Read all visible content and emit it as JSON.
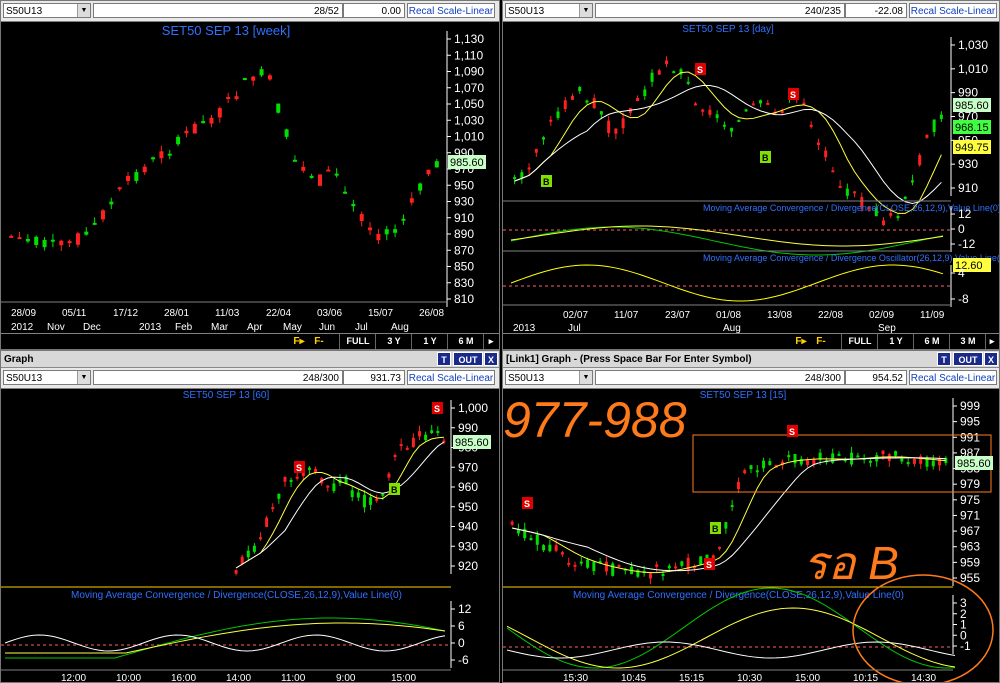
{
  "colors": {
    "up": "#00e000",
    "down": "#ff2020",
    "ma_fast": "#ffff40",
    "ma_slow": "#c8ff80",
    "macd_line": "#00c800",
    "signal_line": "#ffff40",
    "osc": "#ffff00",
    "label": "#3070ff",
    "axis": "#ffffff",
    "grid": "#404040",
    "overlay": "#ff7a1a"
  },
  "panels": {
    "tl": {
      "symbol": "S50U13",
      "field1": "28/52",
      "field2": "0.00",
      "recal": "Recal Scale-Linear",
      "title": "SET50 SEP 13  [week]",
      "yticks": [
        "1,130",
        "1,110",
        "1,090",
        "1,070",
        "1,050",
        "1,030",
        "1,010",
        "990",
        "970",
        "950",
        "930",
        "910",
        "890",
        "870",
        "850",
        "830",
        "810"
      ],
      "price_tag": "985.60",
      "xtick_top": [
        "28/09",
        "05/11",
        "17/12",
        "28/01",
        "11/03",
        "22/04",
        "03/06",
        "15/07",
        "26/08"
      ],
      "xtick_bottom": [
        "2012",
        "Nov",
        "Dec",
        "2013",
        "Feb",
        "Mar",
        "Apr",
        "May",
        "Jun",
        "Jul",
        "Aug"
      ],
      "bottom": {
        "full": "FULL",
        "y3": "3 Y",
        "y1": "1 Y",
        "m6": "6 M"
      }
    },
    "tr": {
      "symbol": "S50U13",
      "field1": "240/235",
      "field2": "-22.08",
      "recal": "Recal Scale-Linear",
      "title": "SET50 SEP 13  [day]",
      "yticks": [
        "1,030",
        "1,010",
        "990",
        "970",
        "950",
        "930",
        "910"
      ],
      "tags": [
        "985.60",
        "968.15",
        "949.75"
      ],
      "macd_title": "Moving Average Convergence / Divergence(CLOSE,26,12,9),Value Line(0)",
      "macd_ticks": [
        "12",
        "0",
        "-12"
      ],
      "osc_title": "Moving Average Convergence / Divergence Oscillator(26,12,9),Value Line(0)",
      "osc_tag": "12.60",
      "osc_ticks": [
        "4",
        "-8"
      ],
      "xtick_top": [
        "02/07",
        "11/07",
        "23/07",
        "01/08",
        "13/08",
        "22/08",
        "02/09",
        "11/09"
      ],
      "xtick_bottom": [
        "2013",
        "Jul",
        "Aug",
        "Sep"
      ],
      "bottom": {
        "full": "FULL",
        "y1": "1 Y",
        "m6": "6 M",
        "m3": "3 M"
      }
    },
    "bl": {
      "header": "Graph",
      "t": "T",
      "out": "OUT",
      "x": "X",
      "symbol": "S50U13",
      "field1": "248/300",
      "field2": "931.73",
      "recal": "Recal Scale-Linear",
      "title": "SET50 SEP 13  [60]",
      "yticks": [
        "1,000",
        "990",
        "980",
        "970",
        "960",
        "950",
        "940",
        "930",
        "920"
      ],
      "price_tag": "985.60",
      "macd_title": "Moving Average Convergence / Divergence(CLOSE,26,12,9),Value Line(0)",
      "macd_ticks": [
        "12",
        "6",
        "0",
        "-6"
      ],
      "xtick": [
        "12:00",
        "10:00",
        "16:00",
        "14:00",
        "11:00",
        "9:00",
        "15:00"
      ]
    },
    "br": {
      "header": "[Link1] Graph  - (Press Space Bar For Enter Symbol)",
      "t": "T",
      "out": "OUT",
      "x": "X",
      "symbol": "S50U13",
      "field1": "248/300",
      "field2": "954.52",
      "recal": "Recal Scale-Linear",
      "title": "SET50 SEP 13  [15]",
      "yticks": [
        "999",
        "995",
        "991",
        "987",
        "983",
        "979",
        "975",
        "971",
        "967",
        "963",
        "959",
        "955"
      ],
      "price_tag": "985.60",
      "macd_title": "Moving Average Convergence / Divergence(CLOSE,26,12,9),Value Line(0)",
      "macd_ticks": [
        "3",
        "2",
        "1",
        "0",
        "-1"
      ],
      "xtick": [
        "15:30",
        "10:45",
        "15:15",
        "10:30",
        "15:00",
        "10:15",
        "14:30"
      ]
    }
  },
  "overlay": {
    "range_text": "977-988",
    "wait_text": "รอ B"
  },
  "signals": {
    "s": "S",
    "b": "B"
  }
}
